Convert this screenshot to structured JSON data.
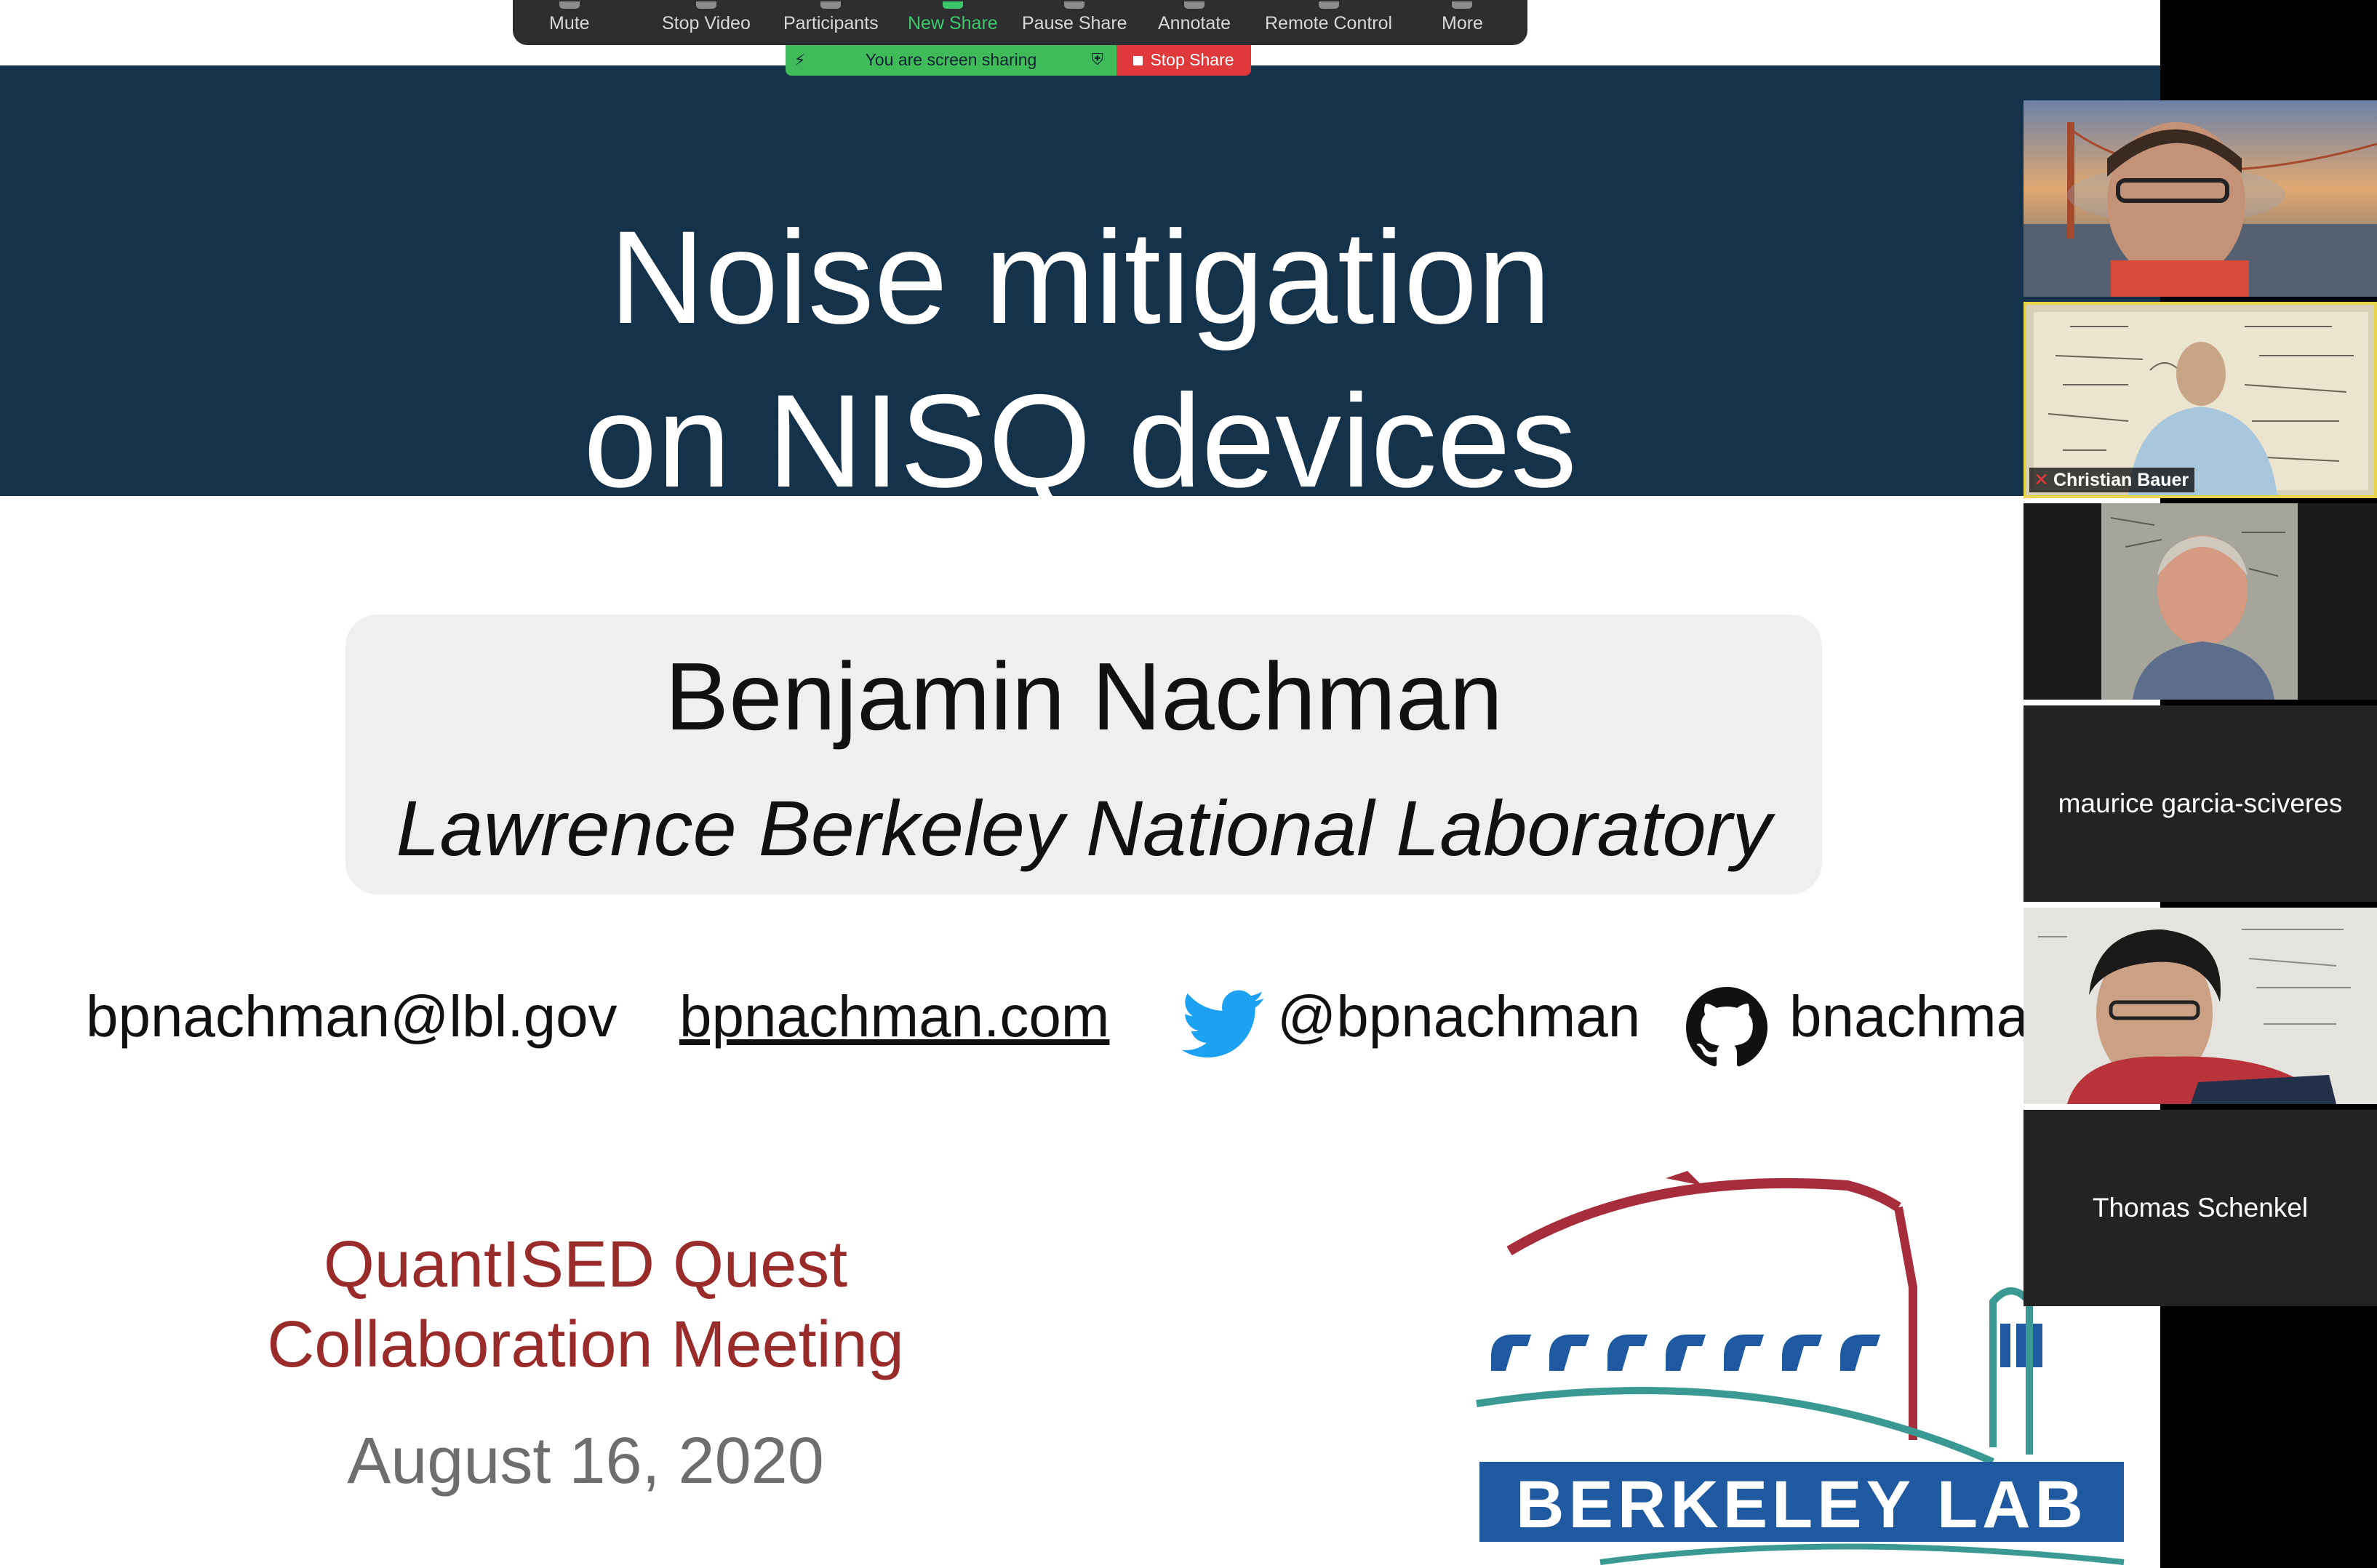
{
  "toolbar": {
    "items": [
      "Mute",
      "Stop Video",
      "Participants",
      "New Share",
      "Pause Share",
      "Annotate",
      "Remote Control",
      "More"
    ],
    "active_item": "New Share",
    "share_banner": "You are screen sharing",
    "stop_share": "Stop Share"
  },
  "slide": {
    "title_line1": "Noise mitigation",
    "title_line2": "on NISQ devices",
    "author": "Benjamin Nachman",
    "affiliation": "Lawrence Berkeley National Laboratory",
    "email": "bpnachman@lbl.gov",
    "website": "bpnachman.com",
    "twitter": "@bpnachman",
    "github": "bnachma",
    "meeting_line1": "QuantISED Quest",
    "meeting_line2": "Collaboration Meeting",
    "date": "August 16, 2020",
    "logo_text": "BERKELEY LAB"
  },
  "participants": [
    {
      "name": "",
      "video": true
    },
    {
      "name": "Christian Bauer",
      "video": true,
      "muted": true,
      "active_speaker": true
    },
    {
      "name": "",
      "video": true
    },
    {
      "name": "maurice garcia-sciveres",
      "video": false
    },
    {
      "name": "",
      "video": true
    },
    {
      "name": "Thomas Schenkel",
      "video": false
    }
  ],
  "colors": {
    "title_band": "#15324b",
    "meeting_red": "#9a2b2b",
    "share_green": "#3fbb5a",
    "stop_red": "#e0393b",
    "logo_blue": "#1f5aa0",
    "logo_red": "#a82d3c",
    "logo_teal": "#3a9a93",
    "twitter_blue": "#1da1f2"
  }
}
